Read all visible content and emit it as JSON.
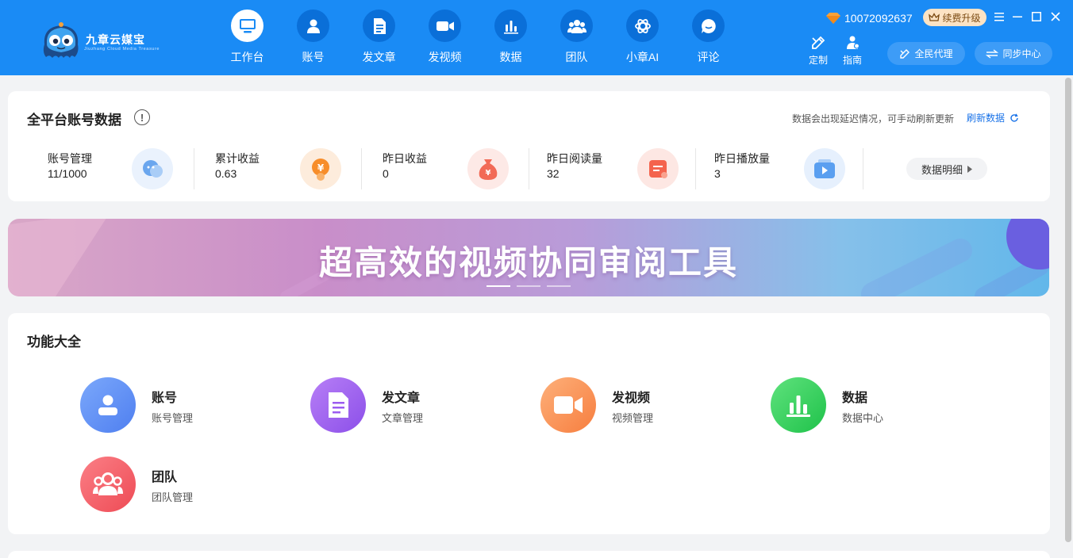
{
  "app": {
    "name": "九章云媒宝",
    "name_en": "Jiuzhang Cloud Media Treasure"
  },
  "nav": [
    {
      "label": "工作台",
      "icon": "monitor-icon",
      "active": true
    },
    {
      "label": "账号",
      "icon": "user-icon"
    },
    {
      "label": "发文章",
      "icon": "document-icon"
    },
    {
      "label": "发视频",
      "icon": "video-camera-icon"
    },
    {
      "label": "数据",
      "icon": "bar-chart-icon"
    },
    {
      "label": "团队",
      "icon": "team-icon"
    },
    {
      "label": "小章AI",
      "icon": "ai-knot-icon"
    },
    {
      "label": "评论",
      "icon": "comment-icon"
    }
  ],
  "header_right": {
    "user_id": "10072092637",
    "renew_label": "续费升级",
    "tools": [
      {
        "label": "定制",
        "icon": "customize-icon"
      },
      {
        "label": "指南",
        "icon": "guide-icon"
      }
    ],
    "agent_label": "全民代理",
    "sync_label": "同步中心"
  },
  "stats": {
    "title": "全平台账号数据",
    "info_icon": "!",
    "delay_note": "数据会出现延迟情况，可手动刷新更新",
    "refresh_label": "刷新数据",
    "items": [
      {
        "label": "账号管理",
        "value": "11/1000",
        "icon": "account-icon"
      },
      {
        "label": "累计收益",
        "value": "0.63",
        "icon": "coin-icon"
      },
      {
        "label": "昨日收益",
        "value": "0",
        "icon": "money-bag-icon"
      },
      {
        "label": "昨日阅读量",
        "value": "32",
        "icon": "read-icon"
      },
      {
        "label": "昨日播放量",
        "value": "3",
        "icon": "play-icon"
      }
    ],
    "detail_label": "数据明细"
  },
  "banner": {
    "text": "超高效的视频协同审阅工具",
    "slides": 3,
    "active_slide": 1
  },
  "functions": {
    "title": "功能大全",
    "items": [
      {
        "title": "账号",
        "sub": "账号管理",
        "icon": "user-icon",
        "color": "#5b8ef5"
      },
      {
        "title": "发文章",
        "sub": "文章管理",
        "icon": "document-icon",
        "color": "#9b5cf0"
      },
      {
        "title": "发视频",
        "sub": "视频管理",
        "icon": "video-camera-icon",
        "color": "#fb8a50"
      },
      {
        "title": "数据",
        "sub": "数据中心",
        "icon": "bar-chart-icon",
        "color": "#2ed05a"
      },
      {
        "title": "团队",
        "sub": "团队管理",
        "icon": "team-icon",
        "color": "#f45d66"
      }
    ]
  }
}
